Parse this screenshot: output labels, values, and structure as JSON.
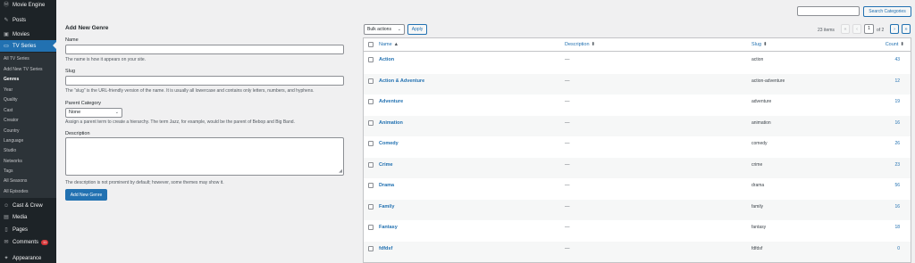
{
  "sidebar": {
    "top": [
      {
        "icon": "wordpress-icon",
        "label": "Movie Engine"
      },
      {
        "icon": "pushpin-icon",
        "label": "Posts"
      },
      {
        "icon": "film-icon",
        "label": "Movies"
      },
      {
        "icon": "tv-icon",
        "label": "TV Series"
      }
    ],
    "submenu": [
      "All TV Series",
      "Add New TV Series",
      "Genres",
      "Year",
      "Quality",
      "Cast",
      "Creator",
      "Country",
      "Language",
      "Studio",
      "Networks",
      "Tags",
      "All Seasons",
      "All Episodes"
    ],
    "bottom": [
      {
        "icon": "users-icon",
        "label": "Cast & Crew"
      },
      {
        "icon": "media-icon",
        "label": "Media"
      },
      {
        "icon": "pages-icon",
        "label": "Pages"
      },
      {
        "icon": "comments-icon",
        "label": "Comments",
        "badge": "11"
      },
      {
        "icon": "appearance-icon",
        "label": "Appearance"
      }
    ]
  },
  "form": {
    "title": "Add New Genre",
    "name_label": "Name",
    "name_value": "",
    "name_help": "The name is how it appears on your site.",
    "slug_label": "Slug",
    "slug_value": "",
    "slug_help": "The “slug” is the URL-friendly version of the name. It is usually all lowercase and contains only letters, numbers, and hyphens.",
    "parent_label": "Parent Category",
    "parent_value": "None",
    "parent_help": "Assign a parent term to create a hierarchy. The term Jazz, for example, would be the parent of Bebop and Big Band.",
    "desc_label": "Description",
    "desc_value": "",
    "desc_help": "The description is not prominent by default; however, some themes may show it.",
    "submit_label": "Add New Genre"
  },
  "search": {
    "placeholder": "",
    "button": "Search Categories"
  },
  "tablenav": {
    "bulk_value": "Bulk actions",
    "apply": "Apply",
    "items": "23 items",
    "first": "«",
    "prev": "‹",
    "page": "1",
    "of": "of 2",
    "next": "›",
    "last": "»"
  },
  "table": {
    "columns": {
      "name": "Name",
      "description": "Description",
      "slug": "Slug",
      "count": "Count"
    },
    "sort_glyph": "⬍",
    "name_sort_glyph": "▲",
    "rows": [
      {
        "name": "Action",
        "description": "—",
        "slug": "action",
        "count": "43"
      },
      {
        "name": "Action & Adventure",
        "description": "—",
        "slug": "action-adventure",
        "count": "12"
      },
      {
        "name": "Adventure",
        "description": "—",
        "slug": "adventure",
        "count": "19"
      },
      {
        "name": "Animation",
        "description": "—",
        "slug": "animation",
        "count": "16"
      },
      {
        "name": "Comedy",
        "description": "—",
        "slug": "comedy",
        "count": "26"
      },
      {
        "name": "Crime",
        "description": "—",
        "slug": "crime",
        "count": "23"
      },
      {
        "name": "Drama",
        "description": "—",
        "slug": "drama",
        "count": "56"
      },
      {
        "name": "Family",
        "description": "—",
        "slug": "family",
        "count": "16"
      },
      {
        "name": "Fantasy",
        "description": "—",
        "slug": "fantasy",
        "count": "18"
      },
      {
        "name": "fdfdsf",
        "description": "—",
        "slug": "fdfdsf",
        "count": "0"
      }
    ]
  },
  "colors": {
    "accent": "#2271b1",
    "sidebar_bg": "#1d2327",
    "submenu_bg": "#2c3338",
    "badge": "#d63638"
  }
}
